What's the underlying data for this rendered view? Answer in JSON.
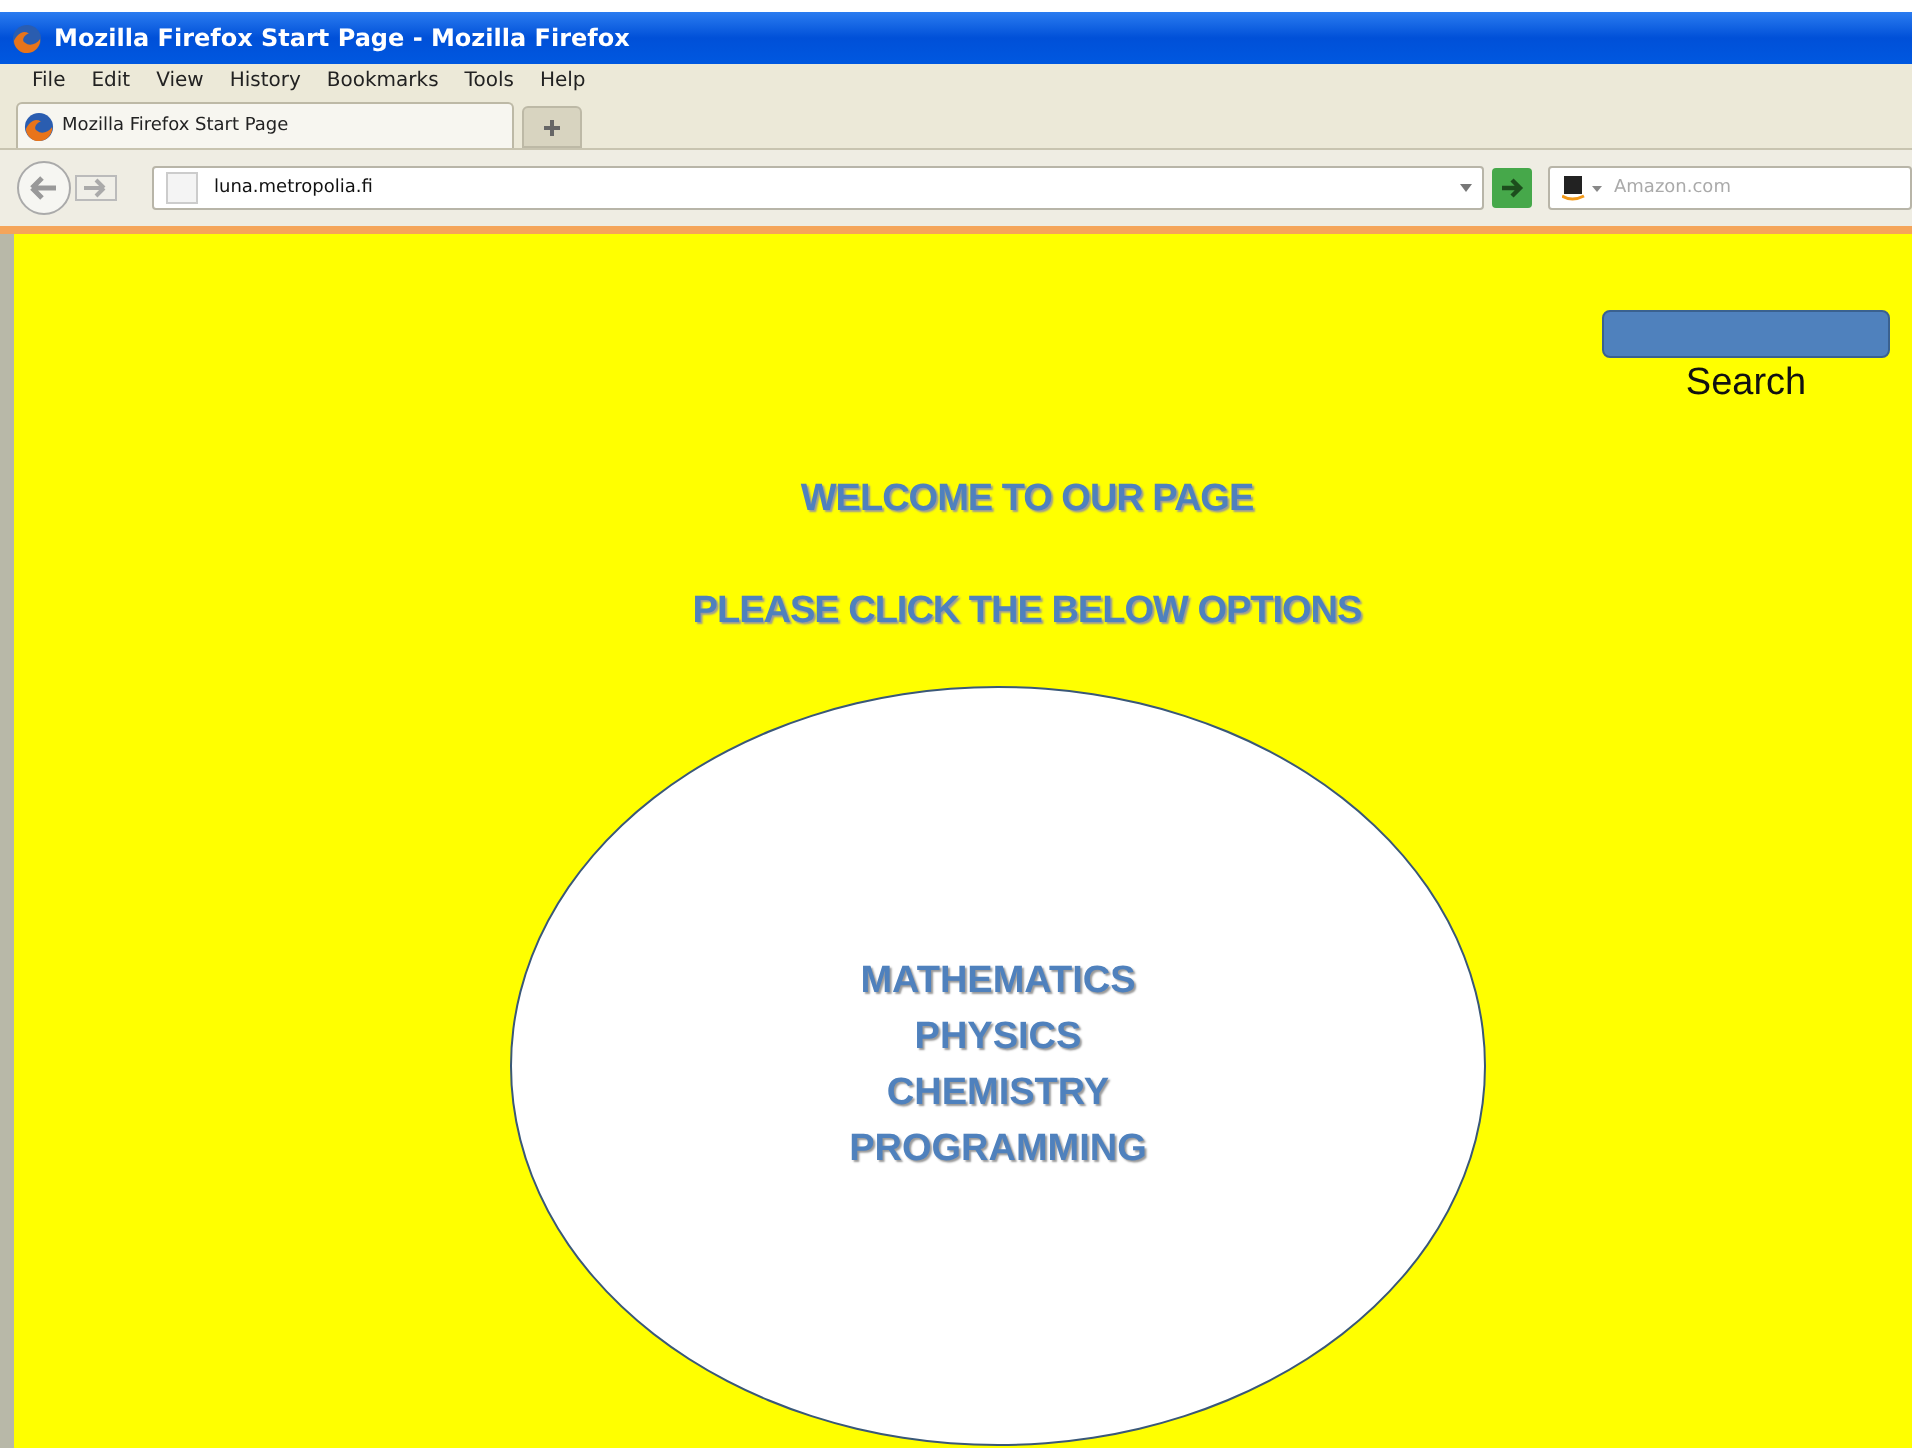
{
  "window": {
    "title": "Mozilla Firefox Start Page - Mozilla Firefox"
  },
  "menu": [
    "File",
    "Edit",
    "View",
    "History",
    "Bookmarks",
    "Tools",
    "Help"
  ],
  "tabs": [
    {
      "label": "Mozilla Firefox Start Page",
      "selected": true
    }
  ],
  "address_bar": {
    "value": "luna.metropolia.fi"
  },
  "search_bar": {
    "placeholder": "Amazon.com"
  },
  "page": {
    "search_label": "Search",
    "headings": [
      "WELCOME TO OUR PAGE",
      "PLEASE CLICK THE BELOW OPTIONS"
    ],
    "options": [
      "MATHEMATICS",
      "PHYSICS",
      "CHEMISTRY",
      "PROGRAMMING"
    ]
  }
}
